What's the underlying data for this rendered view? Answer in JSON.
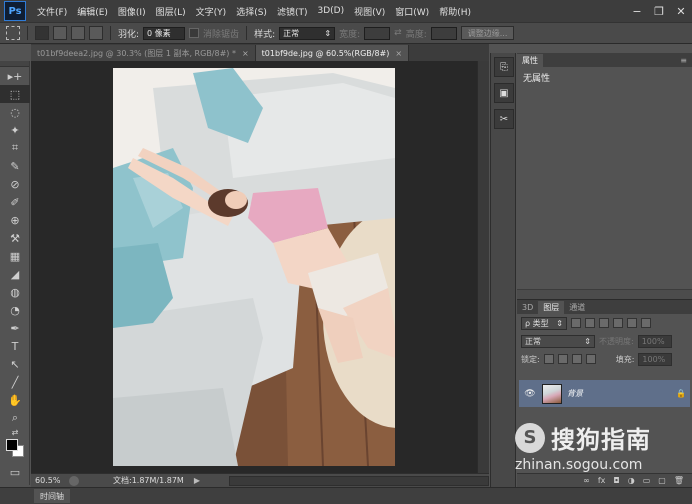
{
  "app": {
    "logo": "Ps"
  },
  "menu": [
    "文件(F)",
    "编辑(E)",
    "图像(I)",
    "图层(L)",
    "文字(Y)",
    "选择(S)",
    "滤镜(T)",
    "3D(D)",
    "视图(V)",
    "窗口(W)",
    "帮助(H)"
  ],
  "window_controls": {
    "minimize": "−",
    "restore": "❐",
    "close": "✕"
  },
  "options": {
    "feather_label": "羽化:",
    "feather_value": "0 像素",
    "antialias_label": "消除锯齿",
    "style_label": "样式:",
    "style_value": "正常",
    "width_label": "宽度:",
    "height_label": "高度:",
    "refine_edge_button": "调整边缘..."
  },
  "tabs": [
    {
      "label": "t01bf9deea2.jpg @ 30.3% (图层 1 副本, RGB/8#) *",
      "close": "×"
    },
    {
      "label": "t01bf9de.jpg @ 60.5%(RGB/8#)",
      "close": "×"
    }
  ],
  "tools": [
    "▸+",
    "⬚",
    "◌",
    "✦",
    "⌗",
    "✎",
    "⊘",
    "✐",
    "⊕",
    "⚒",
    "▦",
    "◢",
    "◍",
    "◔",
    "✒",
    "T",
    "↖",
    "╱",
    "✋",
    "⌕",
    "⇄",
    "▭",
    "⊡"
  ],
  "status": {
    "zoom": "60.5%",
    "doc_info": "文档:1.87M/1.87M",
    "arrow": "▶"
  },
  "timeline": {
    "label": "时间轴"
  },
  "properties": {
    "tab": "属性",
    "empty_text": "无属性",
    "tab_arrows": "»",
    "menu_icon": "≡"
  },
  "layers_panel": {
    "tabs": [
      "3D",
      "图层",
      "通道"
    ],
    "filter_label": "ρ 类型",
    "blend_mode": "正常",
    "opacity_label": "不透明度:",
    "opacity_value": "100%",
    "lock_label": "锁定:",
    "fill_label": "填充:",
    "fill_value": "100%",
    "layer_name": "背景",
    "footer_icons": [
      "∞",
      "fx",
      "◘",
      "◑",
      "▭",
      "▢",
      "🗑"
    ]
  },
  "watermark": {
    "logo": "S",
    "title": "搜狗指南",
    "url": "zhinan.sogou.com"
  }
}
